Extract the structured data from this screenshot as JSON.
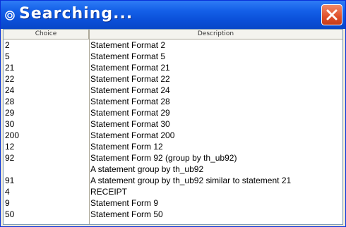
{
  "window": {
    "title": "Searching..."
  },
  "columns": [
    "Choice",
    "Description"
  ],
  "rows": [
    {
      "choice": "2",
      "description": "Statement Format 2"
    },
    {
      "choice": "5",
      "description": "Statement Format 5"
    },
    {
      "choice": "21",
      "description": "Statement Format 21"
    },
    {
      "choice": "22",
      "description": "Statement Format 22"
    },
    {
      "choice": "24",
      "description": "Statement Format 24"
    },
    {
      "choice": "28",
      "description": "Statement Format 28"
    },
    {
      "choice": "29",
      "description": "Statement Format 29"
    },
    {
      "choice": "30",
      "description": "Statement Format 30"
    },
    {
      "choice": "200",
      "description": "Statement Format 200"
    },
    {
      "choice": "12",
      "description": "Statement Form 12"
    },
    {
      "choice": "92",
      "description": "Statement Form 92 (group by th_ub92)"
    },
    {
      "choice": "",
      "description": "A statement group by th_ub92"
    },
    {
      "choice": "91",
      "description": "A statement group by th_ub92 similar to statement 21"
    },
    {
      "choice": "4",
      "description": "RECEIPT"
    },
    {
      "choice": "9",
      "description": "Statement Form 9"
    },
    {
      "choice": "50",
      "description": "Statement Form 50"
    }
  ]
}
